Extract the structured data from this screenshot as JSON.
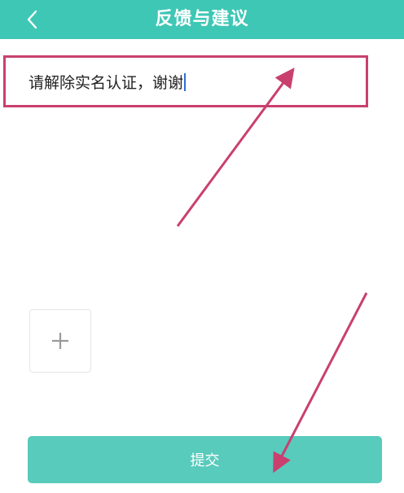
{
  "header": {
    "title": "反馈与建议",
    "back_icon": "chevron-left-icon",
    "background_color": "#3ec7b5"
  },
  "feedback": {
    "value": "请解除实名认证，谢谢",
    "highlight_color": "#c9406f"
  },
  "attachments": {
    "add_icon": "plus-icon"
  },
  "submit": {
    "label": "提交",
    "color": "#58cbbc"
  },
  "annotations": {
    "color": "#c9406f",
    "arrows": [
      {
        "points_to": "feedback-input"
      },
      {
        "points_to": "submit-button"
      }
    ]
  }
}
